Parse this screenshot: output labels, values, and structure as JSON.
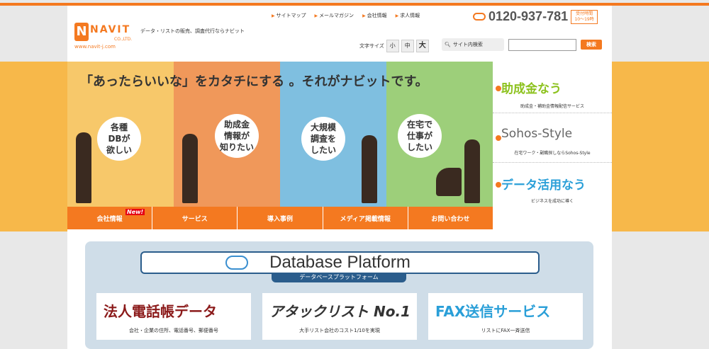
{
  "header": {
    "logo_text": "NAVIT",
    "logo_company": "CO.,LTD.",
    "logo_url": "www.navit-j.com",
    "tagline": "データ・リストの販売、調査代行ならナビット",
    "top_links": [
      "サイトマップ",
      "メールマガジン",
      "会社情報",
      "求人情報"
    ],
    "phone": "0120-937-781",
    "hours": "受付時間 10～19時",
    "font_size_label": "文字サイズ",
    "font_sizes": [
      "小",
      "中",
      "大"
    ],
    "search_label": "サイト内検索",
    "search_value": "",
    "search_button": "検索"
  },
  "hero": {
    "headline": "「あったらいいな」をカタチにする 。それがナビットです。",
    "bubbles": [
      "各種\nDBが\n欲しい",
      "助成金\n情報が\n知りたい",
      "大規模\n調査を\nしたい",
      "在宅で\n仕事が\nしたい"
    ],
    "panel_colors": [
      "#f7c86a",
      "#f0985a",
      "#7fbfe0",
      "#9dcf7a"
    ]
  },
  "nav": {
    "items": [
      "会社情報",
      "サービス",
      "導入事例",
      "メディア掲載情報",
      "お問い合わせ"
    ],
    "new_badge": "New!"
  },
  "side": {
    "items": [
      {
        "title": "助成金なう",
        "sub": "助成金・補助金情報配信サービス",
        "color": "#8dc21f"
      },
      {
        "title": "Sohos-Style",
        "sub": "在宅ワーク・副職探しならSohos-Style",
        "color": "#666666"
      },
      {
        "title": "データ活用なう",
        "sub": "ビジネスを成功に導く",
        "color": "#2a9fd8"
      }
    ]
  },
  "database": {
    "title": "Database Platform",
    "subtitle": "データベースプラットフォーム",
    "cards": [
      {
        "title": "法人電話帳データ",
        "sub": "会社・企業の住所、電話番号、郵便番号"
      },
      {
        "title": "アタックリスト No.1",
        "sub": "大手リスト会社のコスト1/10を実現"
      },
      {
        "title": "FAX送信サービス",
        "sub": "リストにFAX一斉送信"
      }
    ]
  }
}
